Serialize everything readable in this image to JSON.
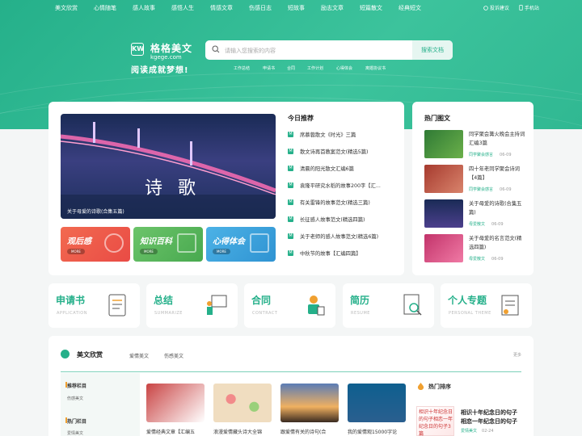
{
  "nav": {
    "items": [
      "美文欣赏",
      "心情随笔",
      "感人故事",
      "感悟人生",
      "情感文章",
      "伤感日志",
      "短故事",
      "励志文章",
      "短篇散文",
      "经典短文"
    ],
    "report": "投诉建议",
    "mobile": "手机站"
  },
  "logo": {
    "mark": "KW",
    "name": "格格美文",
    "domain": "kgege.com",
    "slogan": "阅读成就梦想!"
  },
  "search": {
    "placeholder": "请输入您搜索的内容",
    "button": "搜索文档"
  },
  "tags": [
    "工作总结",
    "申请书",
    "合同",
    "工作计划",
    "心得体会",
    "离婚协议书"
  ],
  "banner": {
    "title": "诗 歌",
    "caption": "关于母爱的诗歌(合集五篇)"
  },
  "tiles": [
    {
      "label": "观后感",
      "more": "MORE",
      "color": "#ef5d4c"
    },
    {
      "label": "知识百科",
      "more": "MORE",
      "color": "#5bb85a"
    },
    {
      "label": "心得体会",
      "more": "MORE",
      "color": "#3aa2db"
    }
  ],
  "today": {
    "title": "今日推荐",
    "items": [
      "席慕蓉散文《时光》三篇",
      "散文诗再首教案范文(精选5篇)",
      "清晨的阳光散文汇编6篇",
      "袁隆平研究水稻的故事200字【汇...",
      "有关雷锋的故事范文(精选三篇)",
      "长征感人故事范文(精选四篇)",
      "关于老师的感人故事范文(精选6篇)",
      "中秋节的故事【汇编四篇】"
    ]
  },
  "hot": {
    "title": "热门图文",
    "items": [
      {
        "title": "同学聚会篝火晚会主持词汇编3篇",
        "category": "同学聚会感言",
        "date": "06-09"
      },
      {
        "title": "四十年老同学聚会诗词【4篇】",
        "category": "同学聚会感言",
        "date": "06-09"
      },
      {
        "title": "关于母爱的诗歌(合集五篇)",
        "category": "母爱散文",
        "date": "06-09"
      },
      {
        "title": "关于母爱的名言范文(精选四篇)",
        "category": "母爱散文",
        "date": "06-09"
      }
    ]
  },
  "categories": [
    {
      "zh": "申请书",
      "en": "APPLICATION"
    },
    {
      "zh": "总结",
      "en": "SUMMARIZE"
    },
    {
      "zh": "合同",
      "en": "CONTRACT"
    },
    {
      "zh": "简历",
      "en": "RESUME"
    },
    {
      "zh": "个人专题",
      "en": "PERSONAL THEME"
    }
  ],
  "section": {
    "title": "美文欣赏",
    "tabs": [
      "爱情美文",
      "伤感美文"
    ],
    "more": "更多",
    "side": [
      {
        "heading": "推荐栏目",
        "sub": "伤感美文"
      },
      {
        "heading": "热门栏目",
        "sub": "爱情美文"
      }
    ],
    "articles": [
      "爱情经典文章【汇编五",
      "浪漫爱情藏头诗大全锦",
      "跟爱情有关的诗句(合",
      "我的爱情观15000字论"
    ],
    "articleColors": [
      "#c94444",
      "#e6c9a0",
      "#5a7cb5",
      "#2a5f8f"
    ],
    "rank": {
      "title": "热门排序",
      "top": {
        "title": "相识十年纪念日的句子 相恋一年纪念日的句子",
        "category": "爱情美文",
        "date": "02-24",
        "thumb": "相识十年纪念日的句子相恋一年纪念日的句子3篇"
      }
    }
  }
}
